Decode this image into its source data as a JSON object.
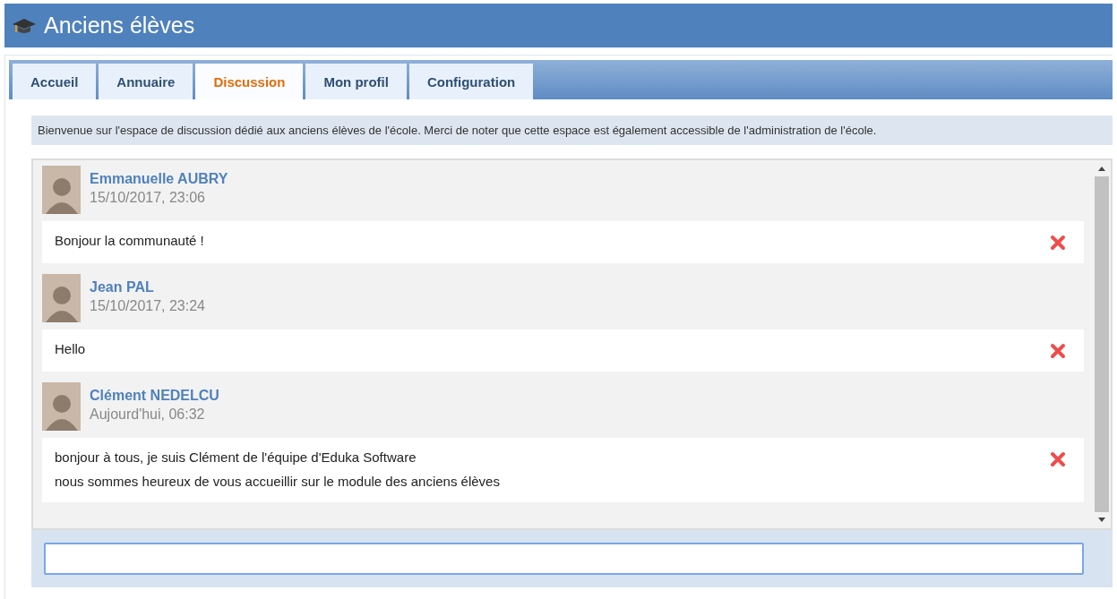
{
  "window": {
    "title": "Anciens élèves"
  },
  "tabs": [
    {
      "label": "Accueil",
      "selected": false
    },
    {
      "label": "Annuaire",
      "selected": false
    },
    {
      "label": "Discussion",
      "selected": true
    },
    {
      "label": "Mon profil",
      "selected": false
    },
    {
      "label": "Configuration",
      "selected": false
    }
  ],
  "notice": "Bienvenue sur l'espace de discussion dédié aux anciens élèves de l'école. Merci de noter que cette espace est également accessible de l'administration de l'école.",
  "messages": [
    {
      "author": "Emmanuelle AUBRY",
      "date": "15/10/2017, 23:06",
      "lines": [
        "Bonjour la communauté !"
      ]
    },
    {
      "author": "Jean PAL",
      "date": "15/10/2017, 23:24",
      "lines": [
        "Hello"
      ]
    },
    {
      "author": "Clément NEDELCU",
      "date": "Aujourd'hui, 06:32",
      "lines": [
        "bonjour à tous, je suis Clément de l'équipe d'Eduka Software",
        "nous sommes heureux de vous accueillir sur le module des anciens élèves"
      ]
    }
  ]
}
